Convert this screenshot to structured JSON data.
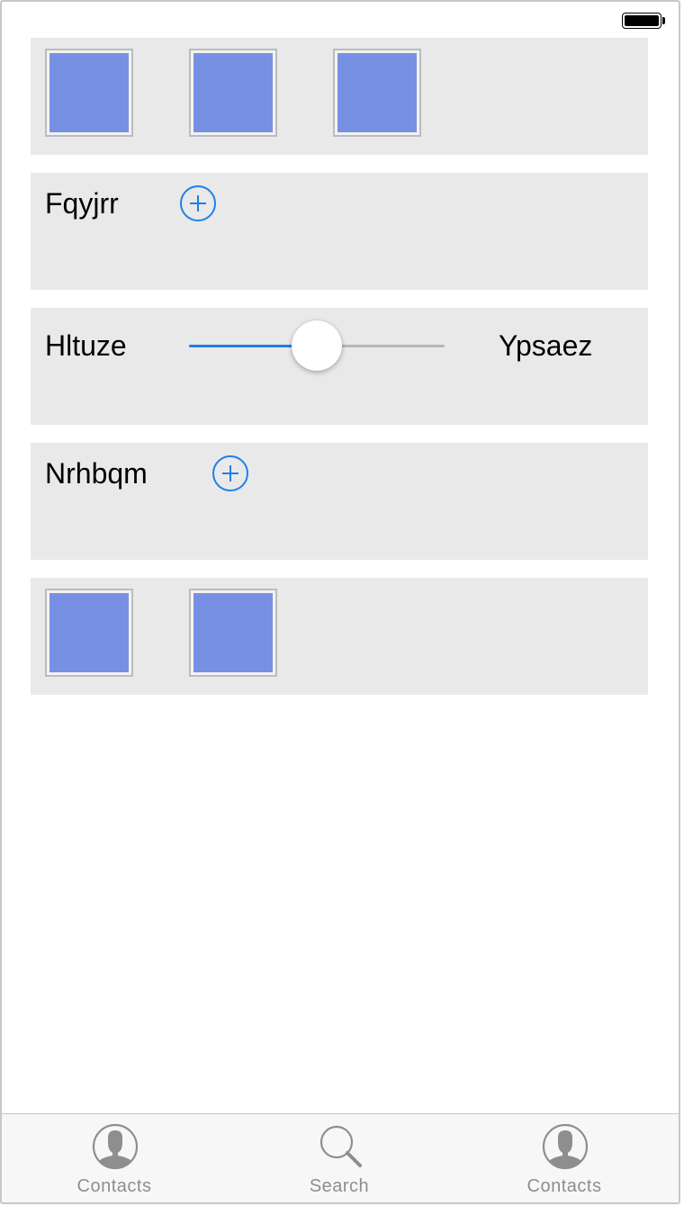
{
  "status_bar": {
    "battery_icon": "battery-full-icon"
  },
  "panels": {
    "first_tiles": [
      {
        "icon": "image-tile",
        "color": "#7890e4"
      },
      {
        "icon": "image-tile",
        "color": "#7890e4"
      },
      {
        "icon": "image-tile",
        "color": "#7890e4"
      }
    ],
    "fqyjrr": {
      "label": "Fqyjrr",
      "add_icon": "plus-circle-icon"
    },
    "slider_row": {
      "left_label": "Hltuze",
      "right_label": "Ypsaez",
      "value": 0.5
    },
    "nrhbqm": {
      "label": "Nrhbqm",
      "add_icon": "plus-circle-icon"
    },
    "last_tiles": [
      {
        "icon": "image-tile",
        "color": "#7890e4"
      },
      {
        "icon": "image-tile",
        "color": "#7890e4"
      }
    ]
  },
  "tab_bar": {
    "tabs": [
      {
        "label": "Contacts",
        "icon": "person-icon"
      },
      {
        "label": "Search",
        "icon": "search-icon"
      },
      {
        "label": "Contacts",
        "icon": "person-icon"
      }
    ]
  },
  "colors": {
    "accent": "#1f7fe8",
    "tile": "#7890e4",
    "panel_bg": "#e9e9e9"
  }
}
